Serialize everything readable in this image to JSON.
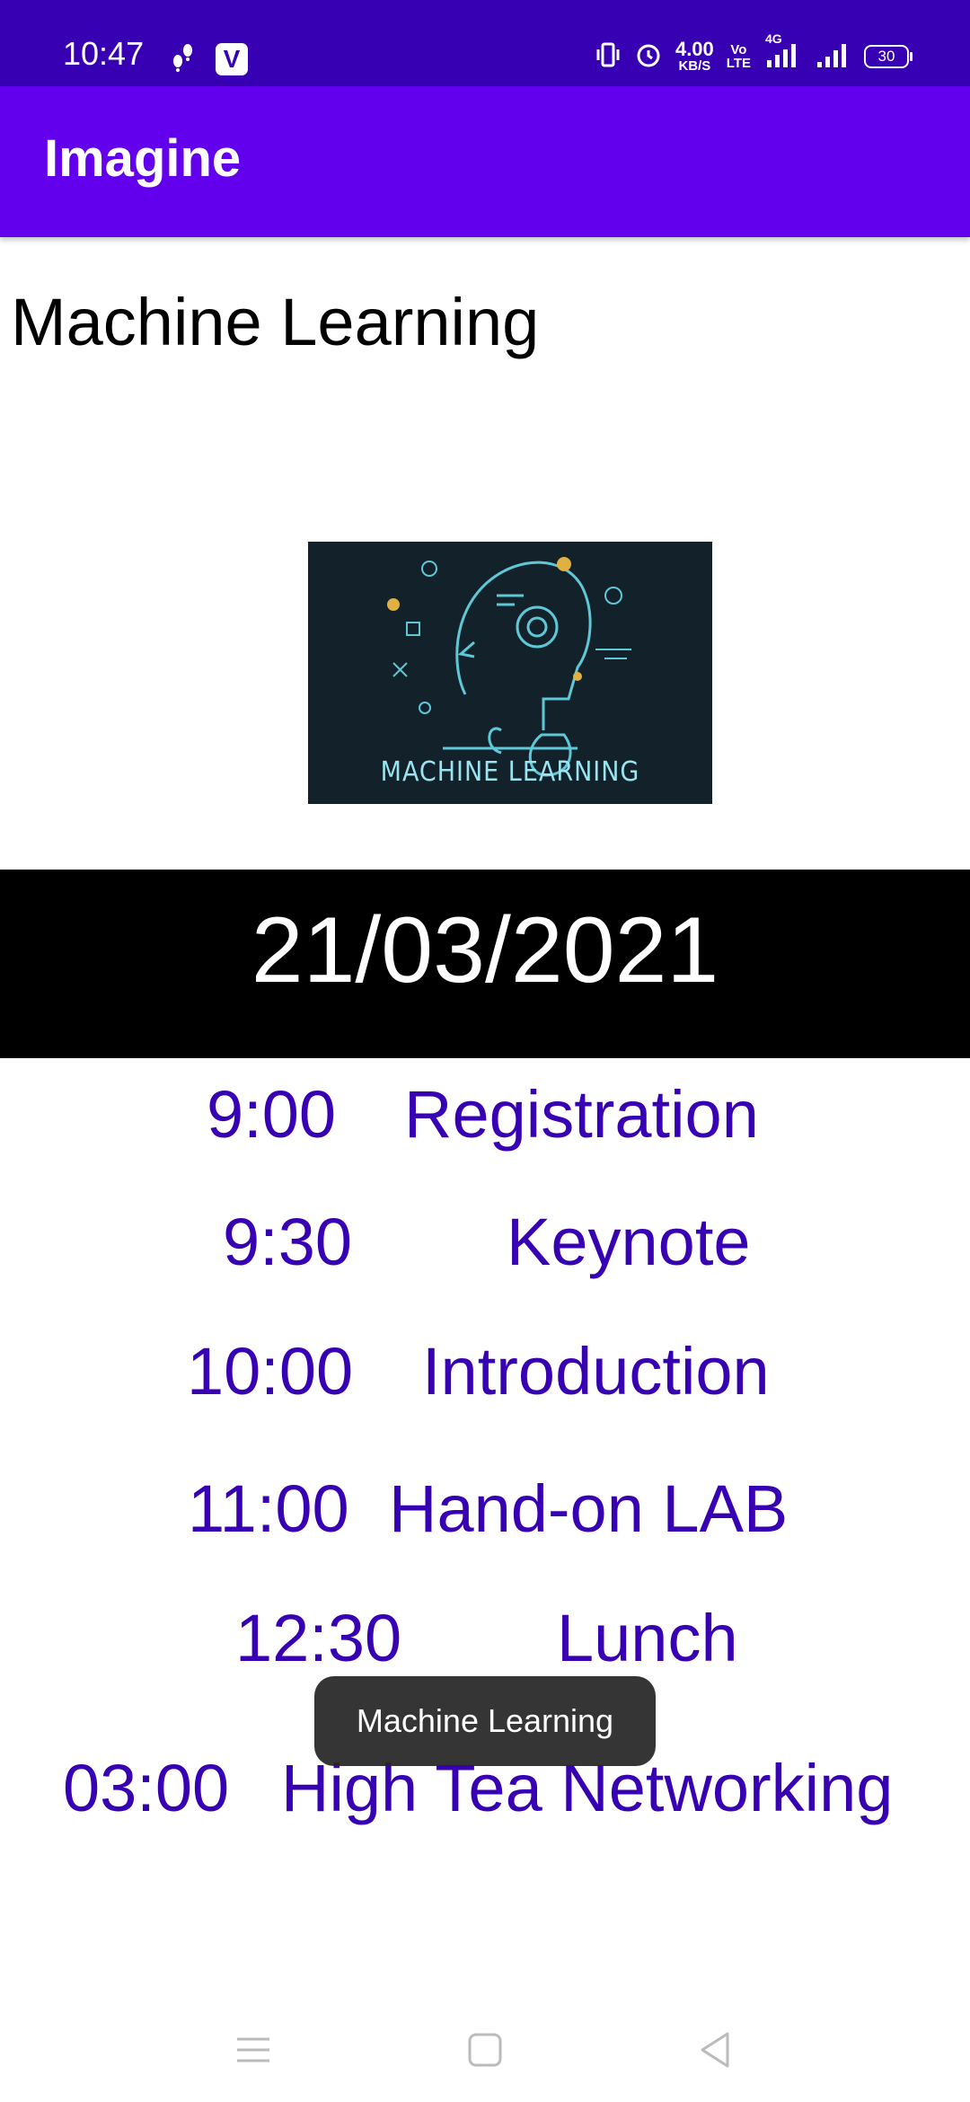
{
  "status_bar": {
    "time": "10:47",
    "net_speed_value": "4.00",
    "net_speed_unit": "KB/S",
    "volte_top": "Vo",
    "volte_bottom": "LTE",
    "network_type": "4G",
    "battery": "30",
    "icons": [
      "footsteps-icon",
      "v-app-icon",
      "vibrate-icon",
      "alarm-icon",
      "signal-icon",
      "battery-icon"
    ]
  },
  "app_bar": {
    "title": "Imagine",
    "color": "#6200ee"
  },
  "main": {
    "heading": "Machine Learning",
    "image_caption": "MACHINE LEARNING",
    "date": "21/03/2021",
    "schedule": [
      {
        "time": "9:00",
        "event": "Registration"
      },
      {
        "time": "9:30",
        "event": "Keynote"
      },
      {
        "time": "10:00",
        "event": "Introduction"
      },
      {
        "time": "11:00",
        "event": "Hand-on LAB"
      },
      {
        "time": "12:30",
        "event": "Lunch"
      },
      {
        "time": "03:00",
        "event": "High Tea Networking"
      }
    ],
    "text_color": "#3700b3"
  },
  "toast": {
    "message": "Machine Learning"
  },
  "nav_bar": {
    "icons": [
      "recents-icon",
      "home-icon",
      "back-icon"
    ]
  }
}
